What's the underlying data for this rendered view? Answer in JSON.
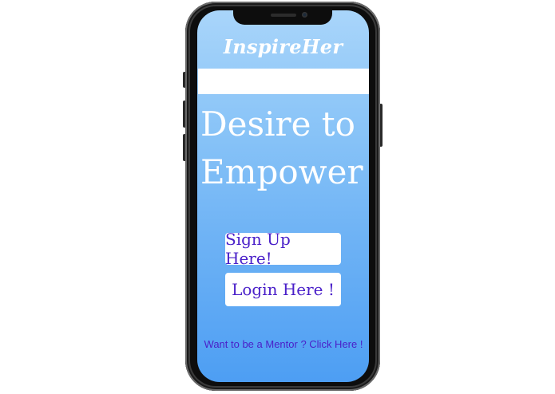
{
  "app": {
    "logo": "InspireHer"
  },
  "hero": {
    "line1": "Desire to",
    "line2": "Empower"
  },
  "actions": {
    "signup_label": "Sign Up Here!",
    "login_label": "Login Here !",
    "mentor_link": "Want to be a Mentor ? Click Here !"
  },
  "colors": {
    "screen_top": "#a9d5fa",
    "screen_bottom": "#4d9ef3",
    "button_text": "#4a20c9",
    "button_bg": "#ffffff"
  }
}
